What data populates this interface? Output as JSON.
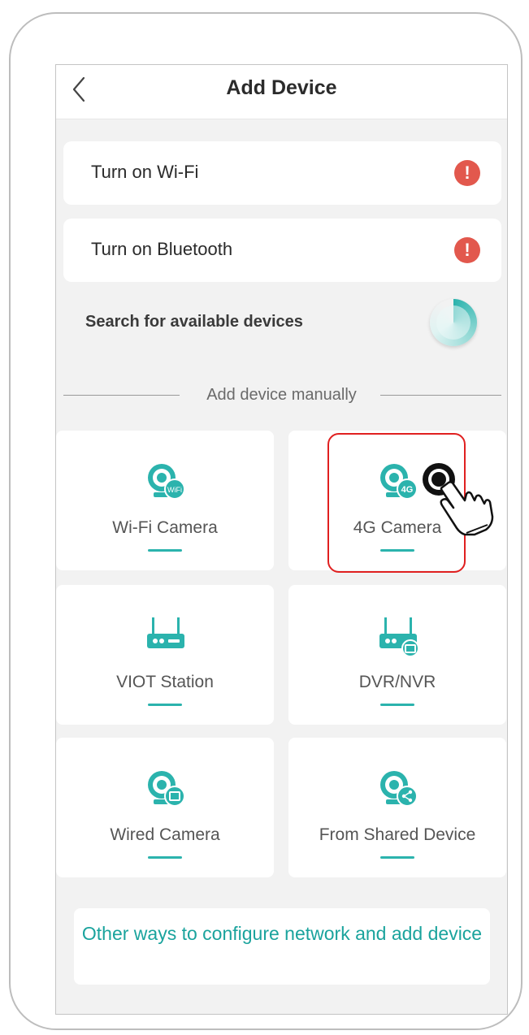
{
  "header": {
    "title": "Add Device",
    "back_icon": "back-chevron-icon"
  },
  "permissions": [
    {
      "label": "Turn on Wi-Fi",
      "status_icon": "alert-icon",
      "status_color": "#e2584d"
    },
    {
      "label": "Turn on Bluetooth",
      "status_icon": "alert-icon",
      "status_color": "#e2584d"
    }
  ],
  "search": {
    "label": "Search for available devices",
    "icon": "searching-spinner-icon"
  },
  "manual": {
    "divider_label": "Add device manually"
  },
  "devices": [
    {
      "label": "Wi-Fi Camera",
      "icon": "wifi-camera-icon",
      "badge": "WiFi"
    },
    {
      "label": "4G Camera",
      "icon": "4g-camera-icon",
      "badge": "4G"
    },
    {
      "label": "VIOT Station",
      "icon": "station-router-icon"
    },
    {
      "label": "DVR/NVR",
      "icon": "dvr-nvr-icon"
    },
    {
      "label": "Wired Camera",
      "icon": "wired-camera-icon"
    },
    {
      "label": "From Shared Device",
      "icon": "shared-camera-icon"
    }
  ],
  "other_ways": {
    "label": "Other ways to configure network and add device"
  },
  "overlay": {
    "highlight_target": "4G Camera",
    "pointer_icon": "hand-tap-icon",
    "highlight_color": "#e02020"
  },
  "colors": {
    "accent": "#2bb3ad",
    "alert": "#e2584d",
    "background": "#f2f2f2"
  }
}
